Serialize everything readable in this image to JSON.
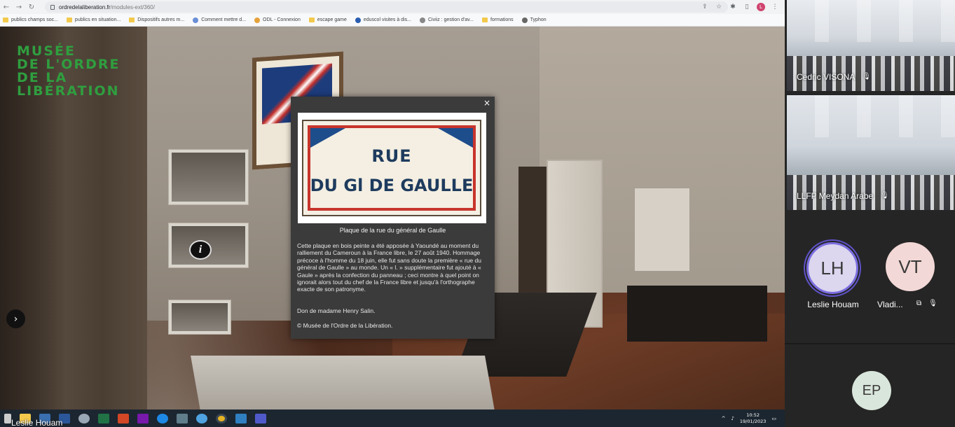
{
  "browser": {
    "url_host": "ordredelaliberation.fr",
    "url_path": "/modules-ext/360/",
    "profile_initial": "L",
    "bookmarks": [
      {
        "label": "publics champs soc...",
        "type": "folder"
      },
      {
        "label": "publics en situation...",
        "type": "folder"
      },
      {
        "label": "Dispositifs autres m...",
        "type": "folder"
      },
      {
        "label": "Comment mettre d...",
        "type": "site"
      },
      {
        "label": "ODL - Connexion",
        "type": "site"
      },
      {
        "label": "escape game",
        "type": "folder"
      },
      {
        "label": "eduscol visites à dis...",
        "type": "site"
      },
      {
        "label": "Civiiz : gestion d'av...",
        "type": "site"
      },
      {
        "label": "formations",
        "type": "folder"
      },
      {
        "label": "Typhon",
        "type": "site"
      }
    ]
  },
  "museum": {
    "logo_lines": [
      "MUSÉE",
      "DE L'ORDRE",
      "DE LA",
      "LIBÉRATION"
    ],
    "info_hotspot_glyph": "i",
    "nav_arrow_glyph": "›"
  },
  "modal": {
    "close_glyph": "×",
    "plaque_line1": "RUE",
    "plaque_line2": "DU Gl DE GAULLE",
    "caption": "Plaque de la rue du général de Gaulle",
    "description": "Cette plaque en bois peinte a été apposée à Yaoundé au moment du ralliement du Cameroun à la France libre, le 27 août 1940. Hommage précoce à l'homme du 18 juin, elle fut sans doute la première « rue du général de Gaulle » au monde.  Un « l. » supplémentaire fut ajouté à « Gaule » après la confection du panneau ; ceci montre à quel point on ignorait alors tout du chef de la France libre et jusqu'à l'orthographe exacte de son patronyme.",
    "donor": "Don de madame Henry Salin.",
    "copyright": "© Musée de l'Ordre de la Libération."
  },
  "taskbar": {
    "presenter": "Leslie Houam",
    "time": "10:52",
    "date": "19/01/2023"
  },
  "participants": {
    "video_tiles": [
      {
        "name": "Cedric VISONA",
        "muted": true
      },
      {
        "name": "LLFP Meydan Arabe",
        "muted": true
      }
    ],
    "avatars": [
      {
        "initials": "LH",
        "name": "Leslie Houam",
        "active": true
      },
      {
        "initials": "VT",
        "name": "Vladi..."
      },
      {
        "initials": "EP",
        "name": ""
      }
    ]
  },
  "colors": {
    "logo_green": "#2f9e3f",
    "modal_bg": "#3b3b3b",
    "active_speaker_ring": "#7b6ee0",
    "taskbar_bg": "#1c2630"
  }
}
